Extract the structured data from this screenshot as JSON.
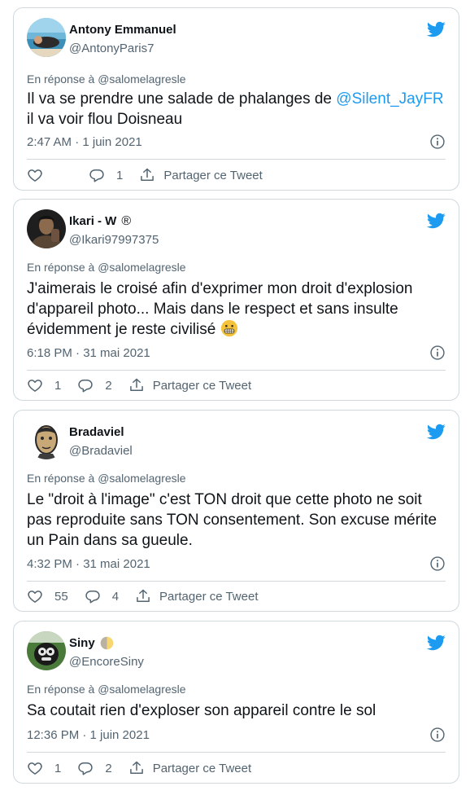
{
  "reply_prefix": "En réponse à",
  "share_label": "Partager ce Tweet",
  "colors": {
    "accent": "#1d9bf0",
    "muted": "#536471",
    "text": "#0f1419",
    "border": "#cfd9de"
  },
  "tweets": [
    {
      "name": "Antony Emmanuel",
      "handle": "@AntonyParis7",
      "reply_to": "@salomelagresle",
      "text_before": "Il va se prendre une salade de phalanges de ",
      "mention": "@Silent_JayFR",
      "text_after": " il va voir flou Doisneau",
      "timestamp": "2:47 AM · 1 juin 2021",
      "likes": "",
      "replies": "1"
    },
    {
      "name": "Ikari - W",
      "badge": "®",
      "handle": "@Ikari97997375",
      "reply_to": "@salomelagresle",
      "text": "J'aimerais le croisé afin d'exprimer mon droit d'explosion d'appareil photo... Mais dans le respect et sans insulte évidemment je reste civilisé",
      "emoji": "grimacing-face",
      "timestamp": "6:18 PM · 31 mai 2021",
      "likes": "1",
      "replies": "2"
    },
    {
      "name": "Bradaviel",
      "handle": "@Bradaviel",
      "reply_to": "@salomelagresle",
      "text": "Le \"droit à l'image\" c'est TON droit que cette photo ne soit pas reproduite sans TON consentement. Son excuse mérite un Pain dans sa gueule.",
      "timestamp": "4:32 PM · 31 mai 2021",
      "likes": "55",
      "replies": "4"
    },
    {
      "name": "Siny",
      "name_emoji": "first-quarter-moon",
      "handle": "@EncoreSiny",
      "reply_to": "@salomelagresle",
      "text": "Sa coutait rien d'exploser son appareil contre le sol",
      "timestamp": "12:36 PM · 1 juin 2021",
      "likes": "1",
      "replies": "2"
    }
  ]
}
